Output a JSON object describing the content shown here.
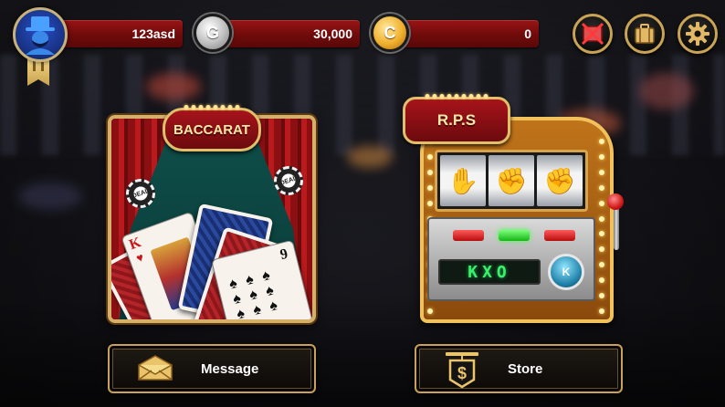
{
  "player": {
    "name": "123asd",
    "avatar_icon": "gentleman-avatar-icon",
    "rank_icon": "rank-ribbon-icon"
  },
  "currency": {
    "silver_symbol": "G",
    "silver_amount": "30,000",
    "gold_symbol": "C",
    "gold_amount": "0"
  },
  "header_buttons": [
    {
      "icon": "no-ads-icon"
    },
    {
      "icon": "bag-icon"
    },
    {
      "icon": "gear-icon"
    }
  ],
  "games": {
    "baccarat": {
      "title": "BACCARAT",
      "chip_label": "DEAL",
      "card_king": "K",
      "card_nine": "9"
    },
    "rps": {
      "title": "R.P.S",
      "display": "KXO",
      "spin_label": "K"
    }
  },
  "bottom_buttons": {
    "message_label": "Message",
    "message_icon": "envelope-icon",
    "store_label": "Store",
    "store_icon": "dollar-sign-icon"
  },
  "colors": {
    "accent_gold": "#c9a456",
    "bar_red": "#8a1010",
    "display_green": "#3bf06a"
  }
}
